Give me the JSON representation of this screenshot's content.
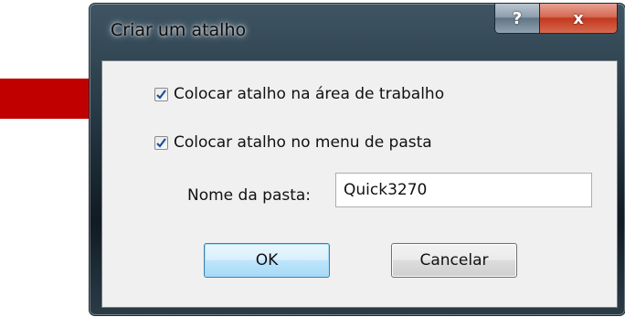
{
  "dialog": {
    "title": "Criar um atalho",
    "help_symbol": "?",
    "close_symbol": "x"
  },
  "options": {
    "desktop_shortcut": {
      "label": "Colocar atalho na área de trabalho",
      "checked": true
    },
    "folder_shortcut": {
      "label": "Colocar atalho no menu de pasta",
      "checked": true
    }
  },
  "folder": {
    "label": "Nome da pasta:",
    "value": "Quick3270"
  },
  "buttons": {
    "ok": "OK",
    "cancel": "Cancelar"
  },
  "colors": {
    "annotation_arrow": "#c00000",
    "checkmark": "#1f4d9b"
  },
  "icons": [
    "pointer-arrow-icon",
    "help-icon",
    "close-icon",
    "checkmark-icon"
  ]
}
